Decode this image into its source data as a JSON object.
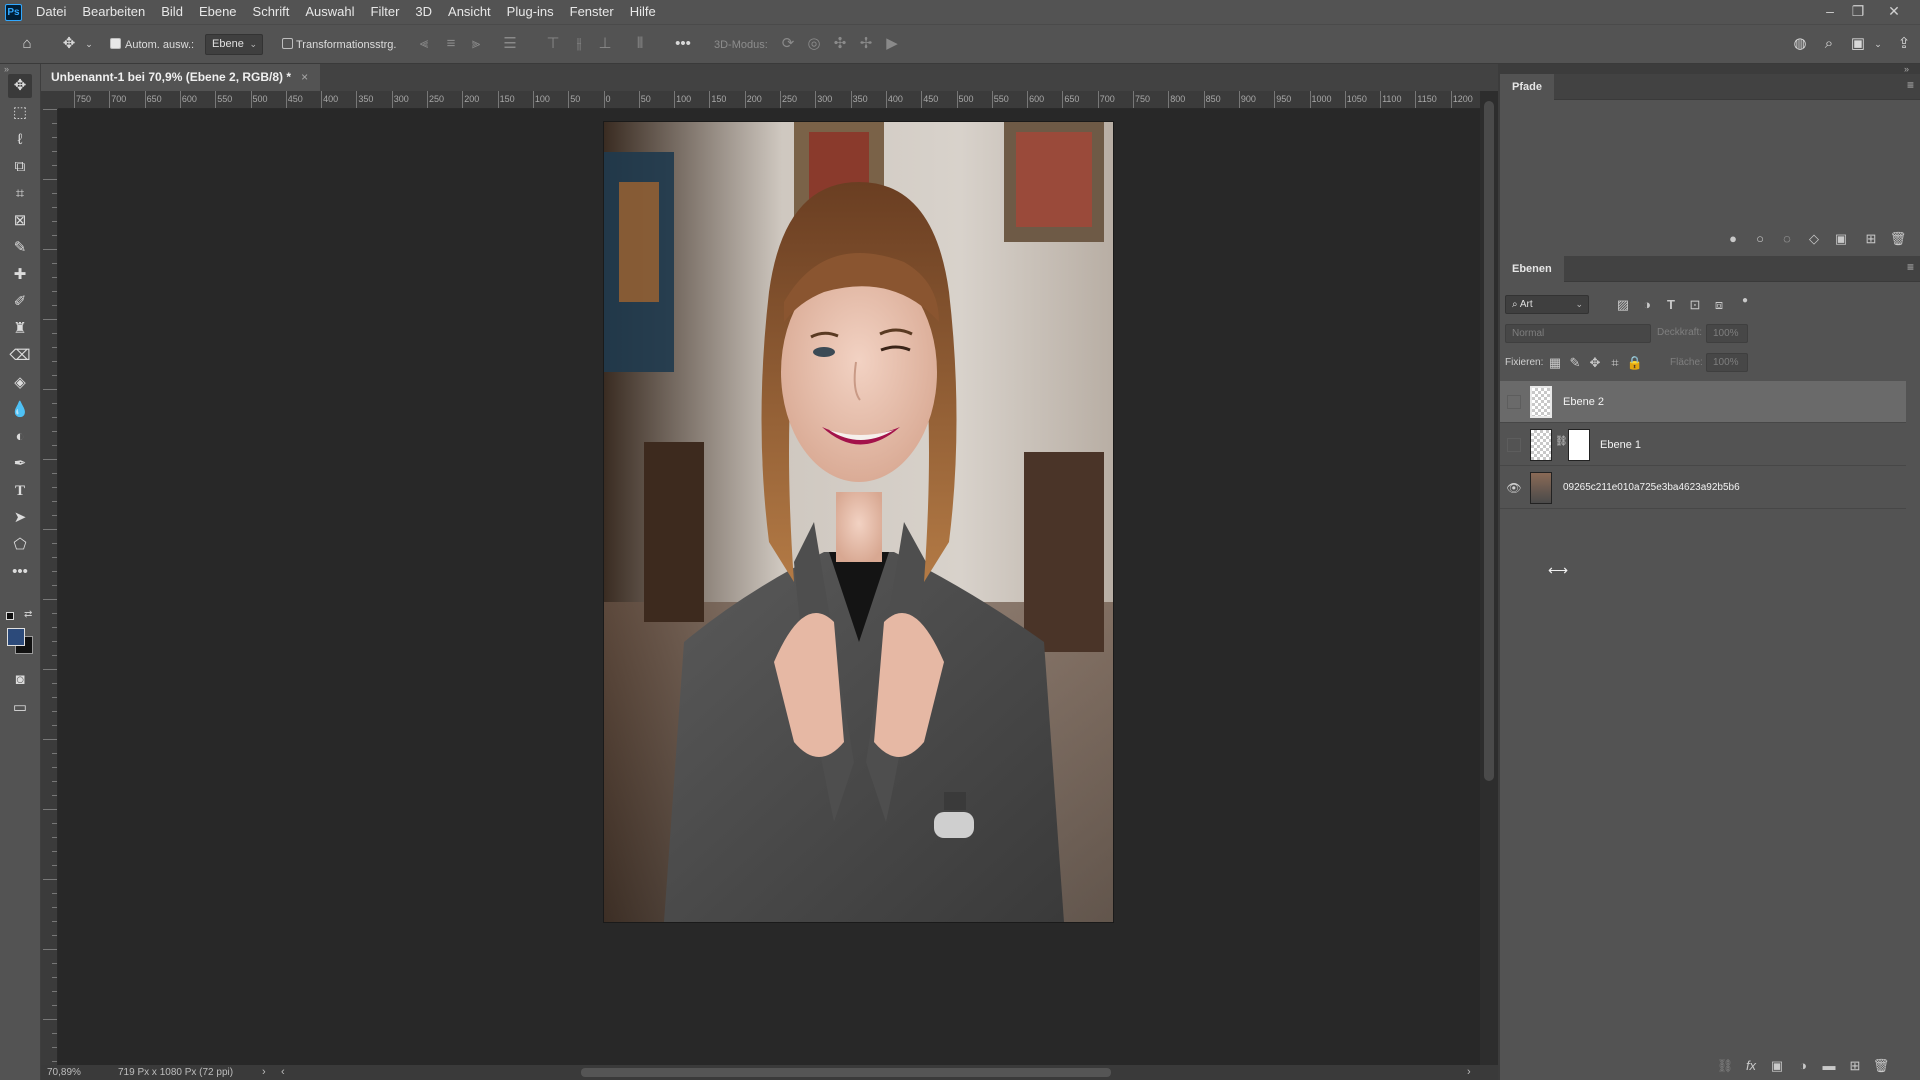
{
  "app": {
    "logo": "Ps"
  },
  "menu": [
    "Datei",
    "Bearbeiten",
    "Bild",
    "Ebene",
    "Schrift",
    "Auswahl",
    "Filter",
    "3D",
    "Ansicht",
    "Plug-ins",
    "Fenster",
    "Hilfe"
  ],
  "options": {
    "auto_select_label": "Autom. ausw.:",
    "auto_select_target": "Ebene",
    "transform_label": "Transformationsstrg.",
    "mode_3d_label": "3D-Modus:"
  },
  "document": {
    "tab_title": "Unbenannt-1 bei 70,9% (Ebene 2, RGB/8) *",
    "tab_close": "×",
    "zoom": "70,89%",
    "doc_info": "719 Px x 1080 Px (72 ppi)"
  },
  "ruler": {
    "top_labels": [
      "750",
      "700",
      "650",
      "600",
      "550",
      "500",
      "450",
      "400",
      "350",
      "300",
      "250",
      "200",
      "150",
      "100",
      "50",
      "0",
      "50",
      "100",
      "150",
      "200",
      "250",
      "300",
      "350",
      "400",
      "450",
      "500",
      "550",
      "600",
      "650",
      "700",
      "750",
      "800",
      "850",
      "900",
      "950",
      "1000",
      "1050",
      "1100",
      "1150",
      "1200"
    ]
  },
  "paths_panel": {
    "tab": "Pfade"
  },
  "layers_panel": {
    "tab": "Ebenen",
    "filter_kind": "Art",
    "blend_mode": "Normal",
    "opacity_label": "Deckkraft:",
    "opacity_value": "100%",
    "lock_label": "Fixieren:",
    "fill_label": "Fläche:",
    "fill_value": "100%",
    "layers": [
      {
        "name": "Ebene 2",
        "visible": false,
        "selected": true
      },
      {
        "name": "Ebene 1",
        "visible": false,
        "selected": false
      },
      {
        "name": "09265c211e010a725e3ba4623a92b5b6",
        "visible": true,
        "selected": false
      }
    ]
  },
  "colors": {
    "foreground": "#2c4a7a",
    "background": "#111111",
    "accent": "#31a8ff"
  }
}
